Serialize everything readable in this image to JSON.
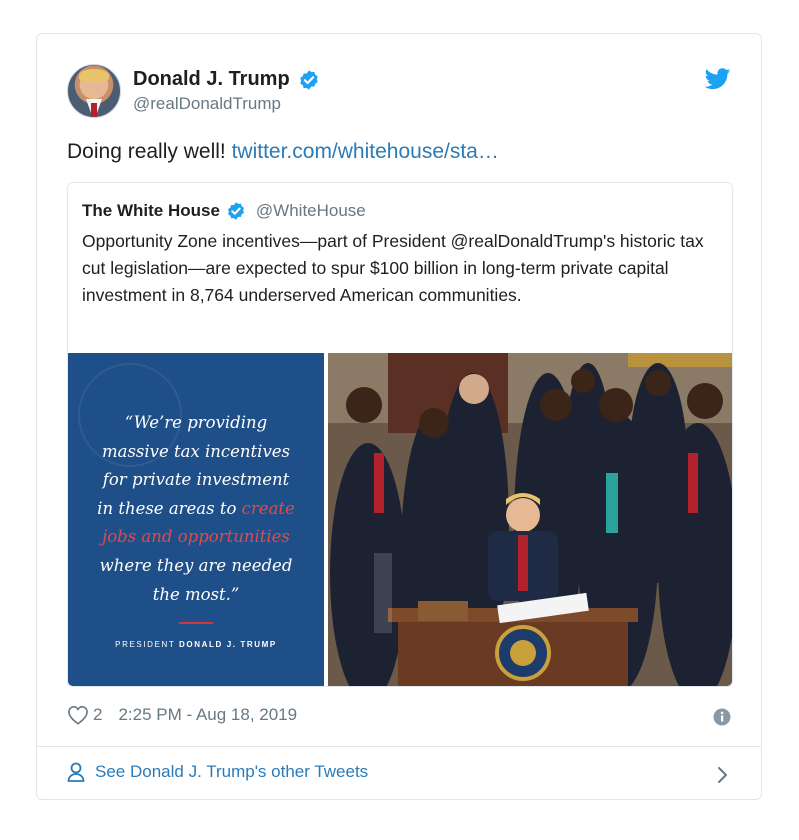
{
  "tweet": {
    "author_name": "Donald J. Trump",
    "author_handle": "@realDonaldTrump",
    "text_plain": "Doing really well! ",
    "text_link": "twitter.com/whitehouse/sta…",
    "likes": "2",
    "timestamp": "2:25 PM - Aug 18, 2019"
  },
  "quoted": {
    "author_name": "The White House",
    "author_handle": "@WhiteHouse",
    "text": "Opportunity Zone incentives—part of President @realDonaldTrump's historic tax cut legislation—are expected to spur $100 billion in long-term private capital investment in 8,764 underserved American communities.",
    "graphic": {
      "line1": "“We’re providing",
      "line2": "massive tax incentives",
      "line3": "for private investment",
      "line4a": "in these areas to ",
      "line4b": "create",
      "line5": "jobs and opportunities",
      "line6": "where they are needed",
      "line7": "the most.”",
      "attribution_prefix": "PRESIDENT ",
      "attribution_name": "DONALD J. TRUMP"
    }
  },
  "footer": {
    "cta_label": "See Donald J. Trump's other Tweets"
  },
  "icons": {
    "verified": "verified-badge-icon",
    "twitter": "twitter-bird-icon",
    "like": "heart-icon",
    "info": "info-icon",
    "user": "user-icon",
    "chevron": "chevron-right-icon"
  },
  "colors": {
    "link": "#2b7bb9",
    "verified": "#1da1f2",
    "muted": "#697882",
    "quote_panel": "#1f4f88",
    "highlight": "#e14a4a"
  }
}
